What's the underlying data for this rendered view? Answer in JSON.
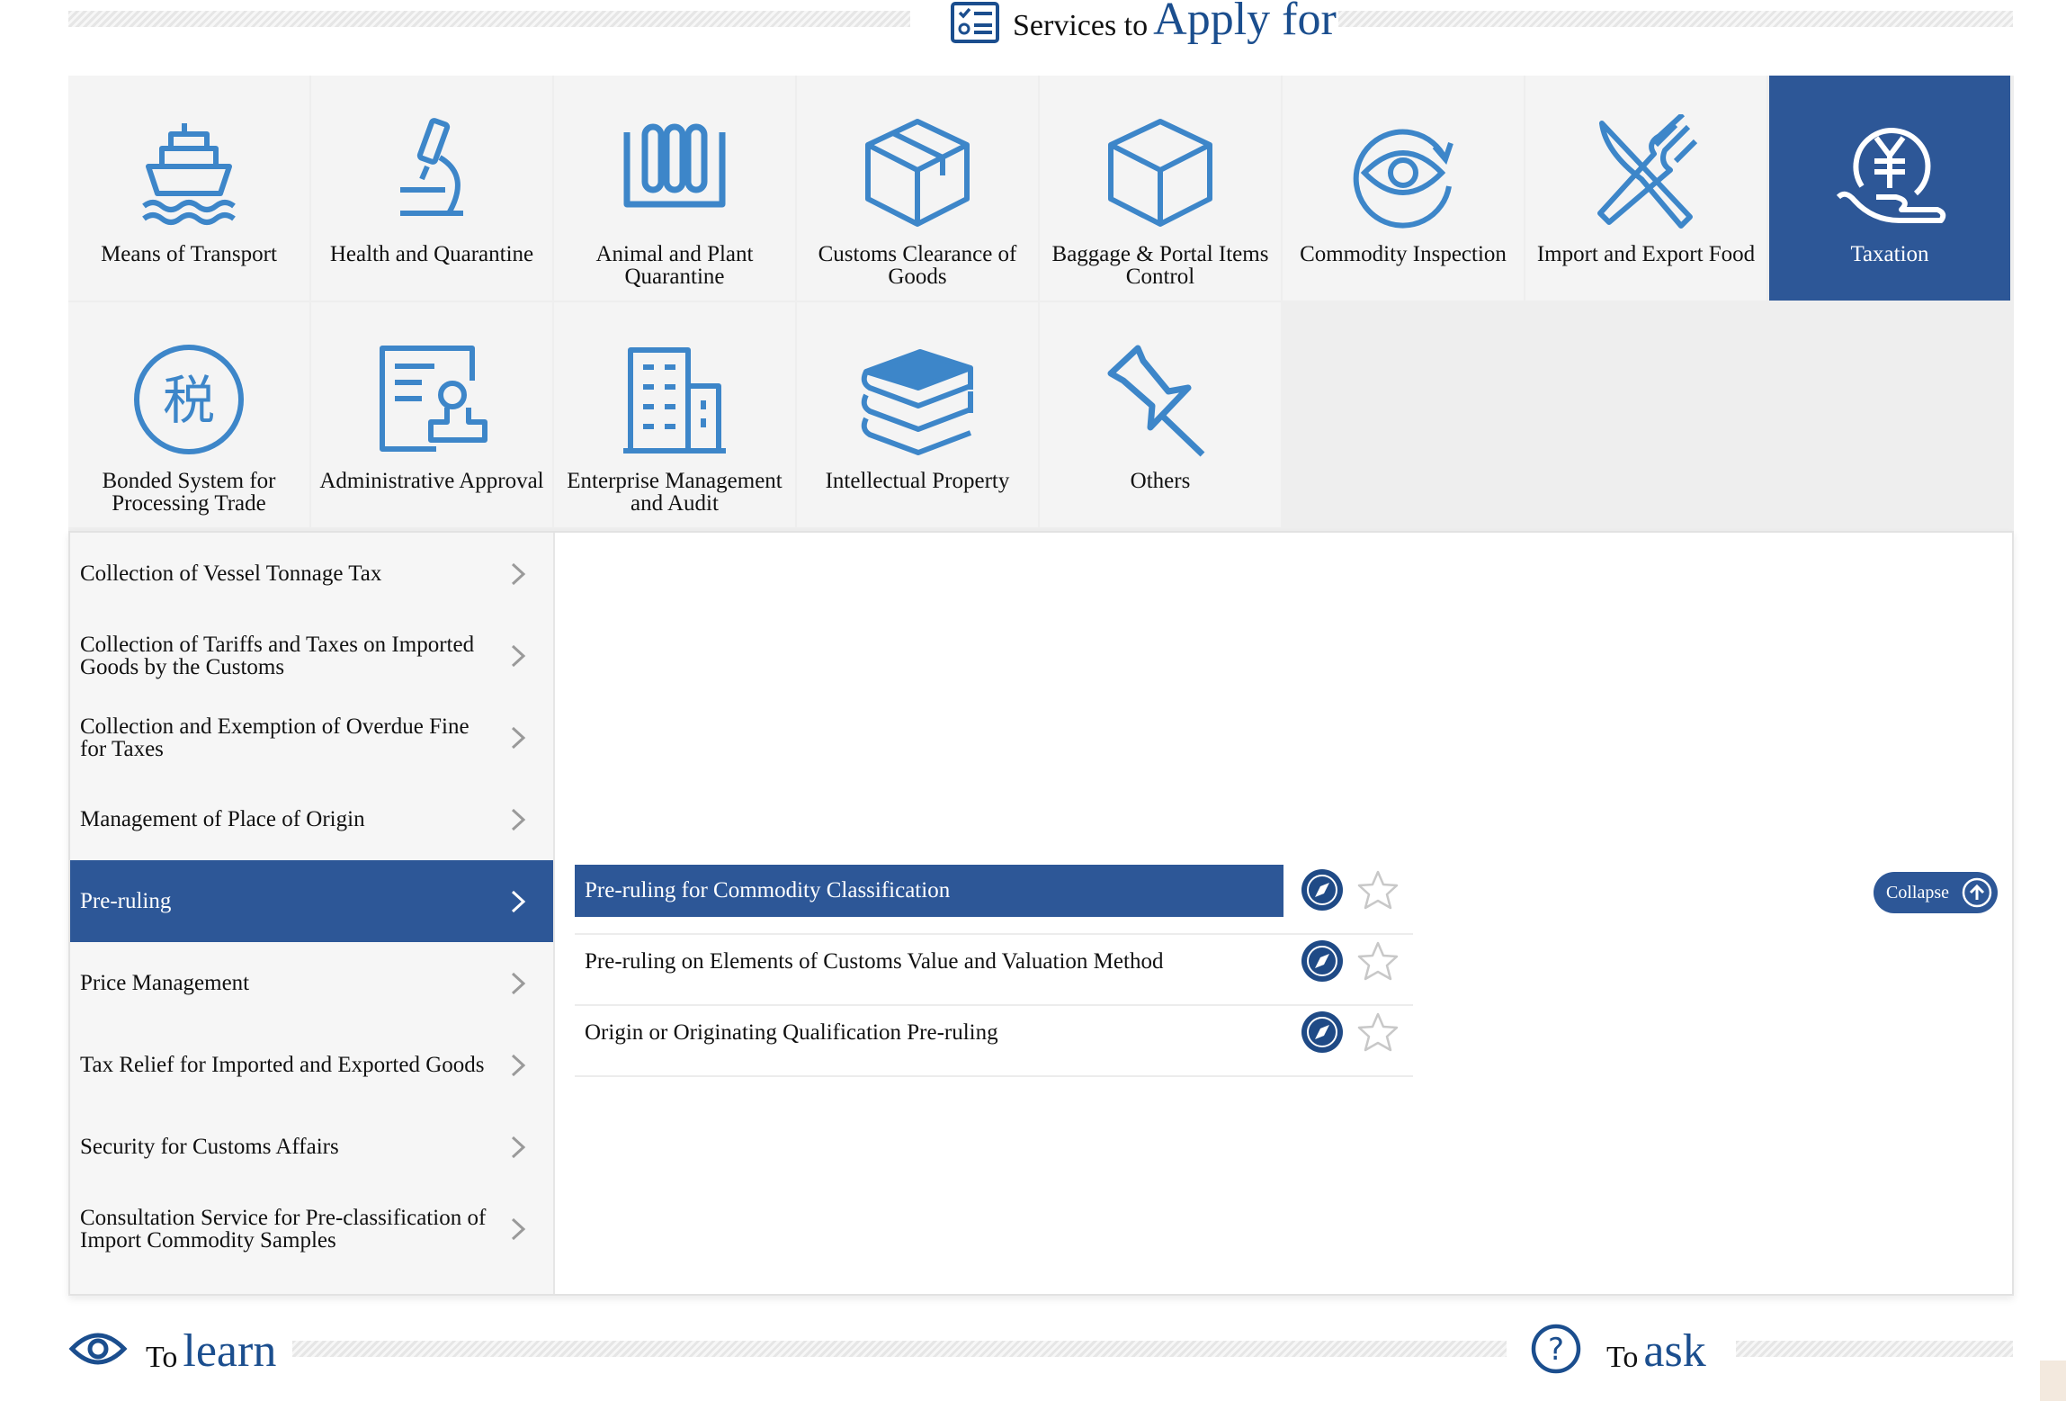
{
  "header_apply": {
    "prefix": "Services to",
    "main": "Apply for",
    "icon": "checklist-icon"
  },
  "categories": [
    {
      "label": "Means of Transport",
      "icon": "ship-icon"
    },
    {
      "label": "Health and Quarantine",
      "icon": "microscope-icon"
    },
    {
      "label": "Animal and Plant\nQuarantine",
      "icon": "test-tubes-icon"
    },
    {
      "label": "Customs Clearance of\nGoods",
      "icon": "open-box-icon"
    },
    {
      "label": "Baggage & Portal Items\nControl",
      "icon": "box-icon"
    },
    {
      "label": "Commodity Inspection",
      "icon": "eye-icon"
    },
    {
      "label": "Import and Export Food",
      "icon": "fork-knife-icon"
    },
    {
      "label": "Taxation",
      "icon": "yen-hand-icon",
      "active": true
    },
    {
      "label": "Bonded System for\nProcessing Trade",
      "icon": "tax-seal-icon"
    },
    {
      "label": "Administrative Approval",
      "icon": "approval-stamp-icon"
    },
    {
      "label": "Enterprise Management\nand Audit",
      "icon": "building-icon"
    },
    {
      "label": "Intellectual Property",
      "icon": "books-icon"
    },
    {
      "label": "Others",
      "icon": "pin-icon"
    }
  ],
  "left_menu": [
    {
      "label": "Collection of Vessel Tonnage Tax"
    },
    {
      "label": "Collection of Tariffs and Taxes on Imported Goods by the Customs"
    },
    {
      "label": "Collection and Exemption of Overdue Fine\n for Taxes"
    },
    {
      "label": "Management of Place of Origin"
    },
    {
      "label": "Pre-ruling",
      "active": true
    },
    {
      "label": "Price Management"
    },
    {
      "label": "Tax Relief for Imported and Exported Goods"
    },
    {
      "label": "Security for Customs Affairs"
    },
    {
      "label": "Consultation Service for Pre-classification of Import Commodity Samples"
    }
  ],
  "sub_items": [
    {
      "label": "Pre-ruling for Commodity Classification",
      "active": true
    },
    {
      "label": "Pre-ruling on Elements of Customs Value and Valuation Method"
    },
    {
      "label": "Origin or Originating Qualification Pre-ruling"
    }
  ],
  "collapse_label": "Collapse",
  "header_learn": {
    "prefix": "To",
    "main": "learn",
    "icon": "eye-icon"
  },
  "header_ask": {
    "prefix": "To",
    "main": "ask",
    "icon": "question-icon"
  },
  "colors": {
    "primary": "#2d5797",
    "icon_blue": "#3d86c9",
    "tile_bg": "#f4f4f4",
    "title_blue": "#1b4e8e"
  }
}
